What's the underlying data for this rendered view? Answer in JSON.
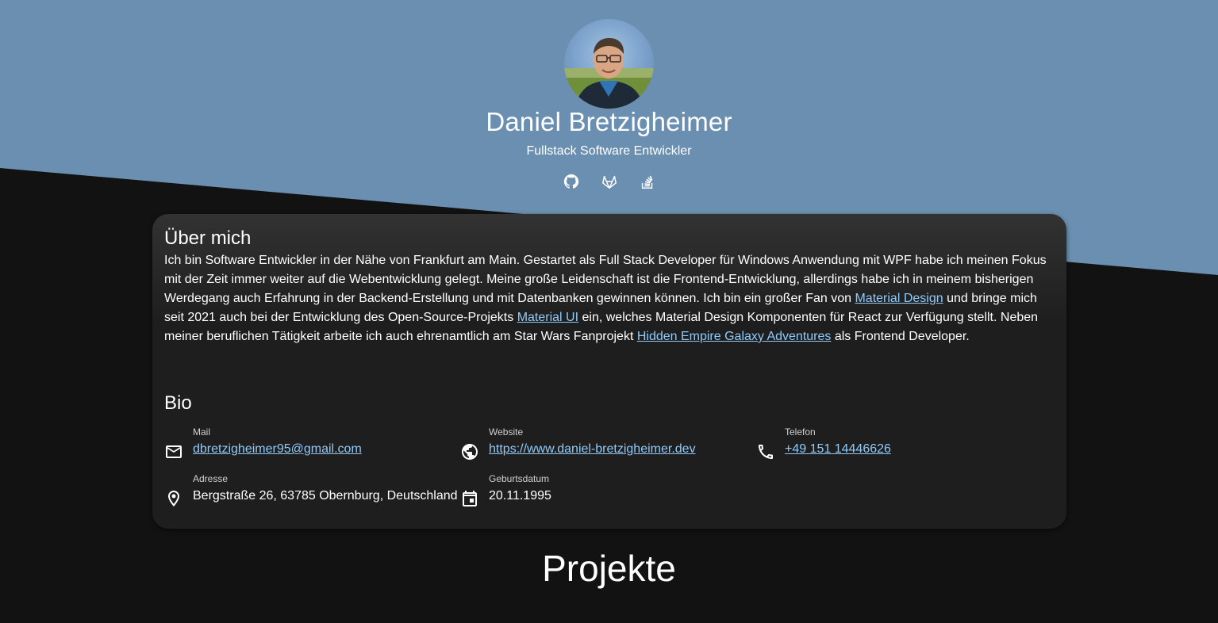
{
  "header": {
    "name": "Daniel Bretzigheimer",
    "title": "Fullstack Software Entwickler",
    "socials": [
      {
        "icon": "github-icon"
      },
      {
        "icon": "gitlab-icon"
      },
      {
        "icon": "stackoverflow-icon"
      }
    ]
  },
  "about": {
    "heading": "Über mich",
    "text_1": "Ich bin Software Entwickler in der Nähe von Frankfurt am Main. Gestartet als Full Stack Developer für Windows Anwendung mit WPF habe ich meinen Fokus mit der Zeit immer weiter auf die Webentwicklung gelegt. Meine große Leidenschaft ist die Frontend-Entwicklung, allerdings habe ich in meinem bisherigen Werdegang auch Erfahrung in der Backend-Erstellung und mit Datenbanken gewinnen können. Ich bin ein großer Fan von ",
    "link_1": "Material Design",
    "text_2": " und bringe mich seit 2021 auch bei der Entwicklung des Open-Source-Projekts ",
    "link_2": "Material UI",
    "text_3": " ein, welches Material Design Komponenten für React zur Verfügung stellt. Neben meiner beruflichen Tätigkeit arbeite ich auch ehrenamtlich am Star Wars Fanprojekt ",
    "link_3": "Hidden Empire Galaxy Adventures",
    "text_4": " als Frontend Developer."
  },
  "bio": {
    "heading": "Bio",
    "mail": {
      "label": "Mail",
      "value": "dbretzigheimer95@gmail.com",
      "icon": "mail-icon"
    },
    "website": {
      "label": "Website",
      "value": "https://www.daniel-bretzigheimer.dev",
      "icon": "globe-icon"
    },
    "phone": {
      "label": "Telefon",
      "value": "+49 151 14446626",
      "icon": "phone-icon"
    },
    "address": {
      "label": "Adresse",
      "value": "Bergstraße 26, 63785 Obernburg, Deutschland",
      "icon": "location-pin-icon"
    },
    "birthday": {
      "label": "Geburtsdatum",
      "value": "20.11.1995",
      "icon": "calendar-icon"
    }
  },
  "projects": {
    "heading": "Projekte"
  },
  "colors": {
    "hero_bg": "#6b8fb0",
    "page_bg": "#121212",
    "card_bg": "#1e1e1e",
    "link": "#90caf9"
  }
}
